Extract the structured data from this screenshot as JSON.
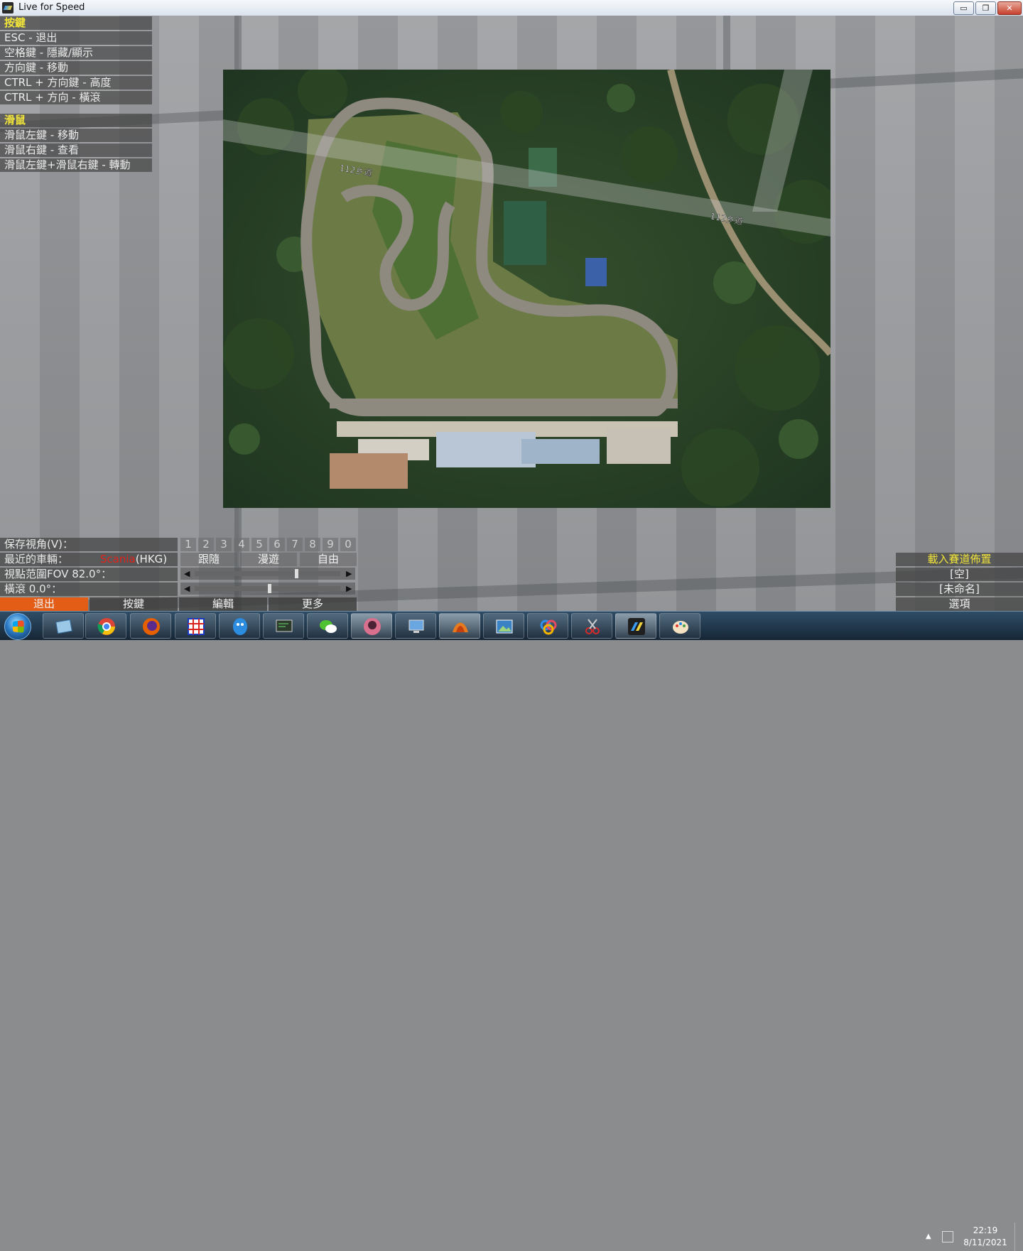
{
  "window": {
    "title": "Live for Speed",
    "controls": {
      "minimize": "▭",
      "maximize": "❐",
      "close": "✕"
    }
  },
  "help": {
    "keys_header": "按鍵",
    "keys": [
      "ESC - 退出",
      "空格鍵 - 隱藏/顯示",
      "方向鍵 - 移動",
      "CTRL + 方向鍵 - 高度",
      "CTRL + 方向 - 橫滾"
    ],
    "mouse_header": "滑鼠",
    "mouse": [
      "滑鼠左鍵 - 移動",
      "滑鼠右鍵 - 查看",
      "滑鼠左鍵+滑鼠右鍵 - 轉動"
    ]
  },
  "map": {
    "road_label_1": "112乡道",
    "road_label_2": "112乡道"
  },
  "view_panel": {
    "save_view_label": "保存視角(V)：",
    "view_slots": [
      "1",
      "2",
      "3",
      "4",
      "5",
      "6",
      "7",
      "8",
      "9",
      "0"
    ],
    "nearest_car_label": "最近的車輛：",
    "nearest_car_name": "Scania",
    "nearest_car_country": "(HKG)",
    "modes": [
      "跟隨",
      "漫遊",
      "自由"
    ],
    "fov_label": "視點范圍FOV 82.0°：",
    "roll_label": "橫滾 0.0°：",
    "fov_value": 0.69,
    "roll_value": 0.5
  },
  "bottom_tabs": {
    "exit": "退出",
    "keys": "按鍵",
    "edit": "編輯",
    "more": "更多"
  },
  "layout_panel": {
    "title": "載入賽道佈置",
    "empty": "[空]",
    "unnamed": "[未命名]",
    "options": "選項"
  },
  "taskbar": {
    "apps": [
      "file-manager",
      "chrome",
      "firefox",
      "grid-app",
      "qq",
      "terminal",
      "wechat",
      "media",
      "computer",
      "matlab",
      "photos",
      "cloud",
      "scissors",
      "lfs",
      "paint"
    ],
    "time": "22:19",
    "date": "8/11/2021"
  },
  "colors": {
    "accent_yellow": "#f1e43a",
    "exit_orange": "#e35d16",
    "car_red": "#e0201a"
  }
}
